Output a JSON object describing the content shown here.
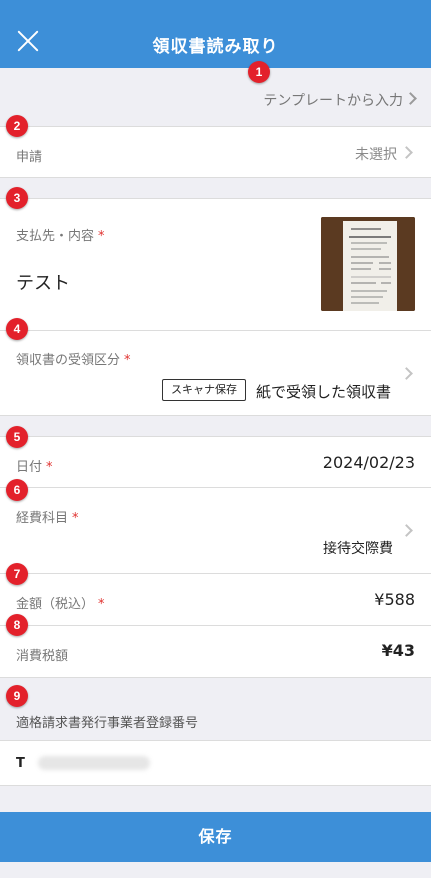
{
  "header": {
    "title": "領収書読み取り"
  },
  "template_link": {
    "label": "テンプレートから入力"
  },
  "application": {
    "label": "申請",
    "value": "未選択"
  },
  "payee": {
    "label": "支払先・内容",
    "required_mark": "*",
    "value": "テスト"
  },
  "receipt_type": {
    "label": "領収書の受領区分",
    "required_mark": "*",
    "tag": "スキャナ保存",
    "value": "紙で受領した領収書"
  },
  "date": {
    "label": "日付",
    "required_mark": "*",
    "value": "2024/02/23"
  },
  "expense_category": {
    "label": "経費科目",
    "required_mark": "*",
    "value": "接待交際費"
  },
  "amount": {
    "label": "金額（税込）",
    "required_mark": "*",
    "value": "¥588"
  },
  "tax": {
    "label": "消費税額",
    "value": "¥43"
  },
  "invoice_registration": {
    "label": "適格請求書発行事業者登録番号",
    "prefix": "T"
  },
  "footer": {
    "save_label": "保存"
  },
  "badges": [
    "1",
    "2",
    "3",
    "4",
    "5",
    "6",
    "7",
    "8",
    "9"
  ],
  "colors": {
    "header": "#3d8fd8",
    "badge": "#e3212b",
    "required": "#e0312f",
    "background": "#efeff4"
  }
}
